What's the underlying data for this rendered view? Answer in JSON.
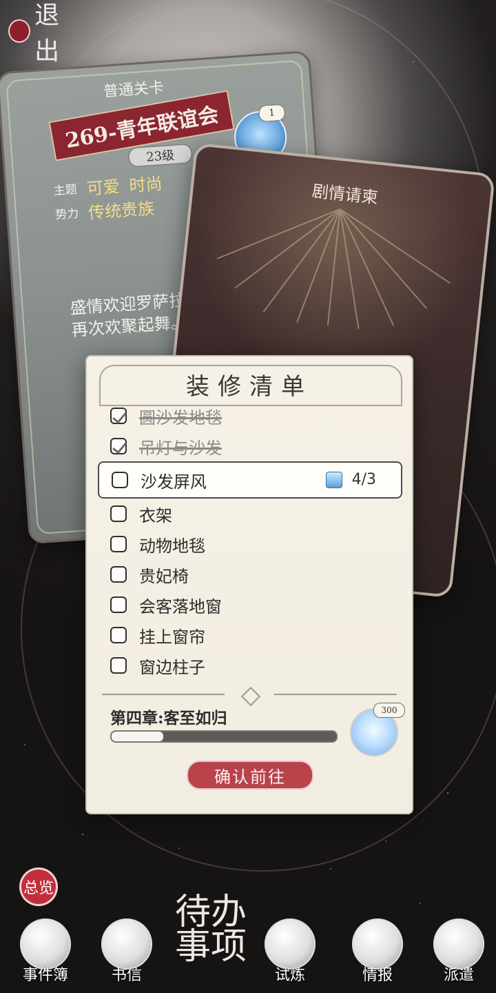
{
  "top": {
    "exit_label": "退出"
  },
  "level_card": {
    "type_label": "普通关卡",
    "title": "269-青年联谊会",
    "level": "23级",
    "crystal_count": "1",
    "theme_label": "主题",
    "themes": [
      "可爱",
      "时尚"
    ],
    "faction_label": "势力",
    "faction": "传统贵族",
    "description": "盛情欢迎罗萨拉的……您再次欢聚起舞。"
  },
  "story_card": {
    "title": "剧情请柬"
  },
  "panel": {
    "title": "装修清单",
    "items": [
      {
        "label": "圆沙发地毯",
        "done": true
      },
      {
        "label": "吊灯与沙发",
        "done": true
      },
      {
        "label": "沙发屏风",
        "done": false,
        "current": true,
        "progress": "4/3"
      },
      {
        "label": "衣架",
        "done": false
      },
      {
        "label": "动物地毯",
        "done": false
      },
      {
        "label": "贵妃椅",
        "done": false
      },
      {
        "label": "会客落地窗",
        "done": false
      },
      {
        "label": "挂上窗帘",
        "done": false
      },
      {
        "label": "窗边柱子",
        "done": false
      }
    ],
    "chapter_title": "第四章:客至如归",
    "chapter_progress": 0.23,
    "reward_count": "300",
    "confirm_label": "确认前往"
  },
  "bottom": {
    "overview_label": "总览",
    "center_title": "待办事项",
    "nav": [
      {
        "label": "事件簿",
        "icon": "event-book-icon"
      },
      {
        "label": "书信",
        "icon": "letter-icon"
      },
      {
        "label": "试炼",
        "icon": "trial-icon"
      },
      {
        "label": "情报",
        "icon": "intel-icon"
      },
      {
        "label": "派遣",
        "icon": "dispatch-icon"
      }
    ]
  },
  "colors": {
    "accent_red": "#b9424b",
    "panel_bg": "#f6f1e6",
    "dark_bg": "#1a1717"
  }
}
